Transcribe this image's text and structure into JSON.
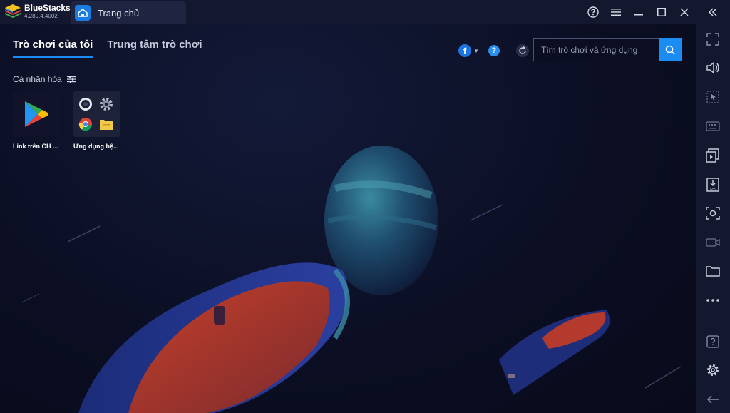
{
  "app": {
    "name": "BlueStacks",
    "version": "4.280.4.4002",
    "tab_title": "Trang chủ"
  },
  "nav": {
    "tabs": [
      {
        "label": "Trò chơi của tôi",
        "active": true
      },
      {
        "label": "Trung tâm trò chơi",
        "active": false
      }
    ]
  },
  "toolbar": {
    "facebook_glyph": "f",
    "help_glyph": "?"
  },
  "search": {
    "placeholder": "Tìm trò chơi và ứng dụng"
  },
  "section": {
    "title": "Cá nhân hóa"
  },
  "apps": [
    {
      "label": "Link trên CH ...",
      "icon": "google-play-icon"
    },
    {
      "label": "Ứng dụng hệ...",
      "icon": "system-apps-folder-icon"
    }
  ],
  "sidebar": {
    "items": [
      "expand-fullscreen-icon",
      "volume-icon",
      "cursor-lock-icon",
      "keyboard-icon",
      "multi-instance-icon",
      "apk-install-icon",
      "screenshot-icon",
      "record-video-icon",
      "folder-icon",
      "more-icon",
      "help-icon",
      "settings-icon",
      "back-arrow-icon"
    ]
  },
  "colors": {
    "accent": "#1b8cf2",
    "titlebar": "#14182e",
    "background": "#0b0e22"
  }
}
